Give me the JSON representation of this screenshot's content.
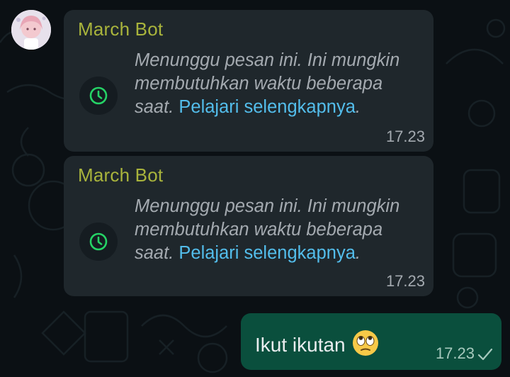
{
  "chat": {
    "messages": [
      {
        "sender": "March Bot",
        "text": "Menunggu pesan ini. Ini mungkin membutuhkan waktu beberapa saat. ",
        "link": "Pelajari selengkapnya",
        "after_link": ".",
        "time": "17.23",
        "icon": "clock-icon"
      },
      {
        "sender": "March Bot",
        "text": "Menunggu pesan ini. Ini mungkin membutuhkan waktu beberapa saat. ",
        "link": "Pelajari selengkapnya",
        "after_link": ".",
        "time": "17.23",
        "icon": "clock-icon"
      }
    ],
    "outgoing": {
      "text": "Ikut ikutan",
      "emoji": "face-with-rolling-eyes",
      "time": "17.23",
      "status": "sent-check"
    }
  },
  "colors": {
    "background": "#0b1014",
    "incoming_bubble": "#1f272c",
    "outgoing_bubble": "#0a4f3d",
    "sender_name": "#a9b43c",
    "link": "#53bdeb",
    "clock": "#25d366"
  }
}
